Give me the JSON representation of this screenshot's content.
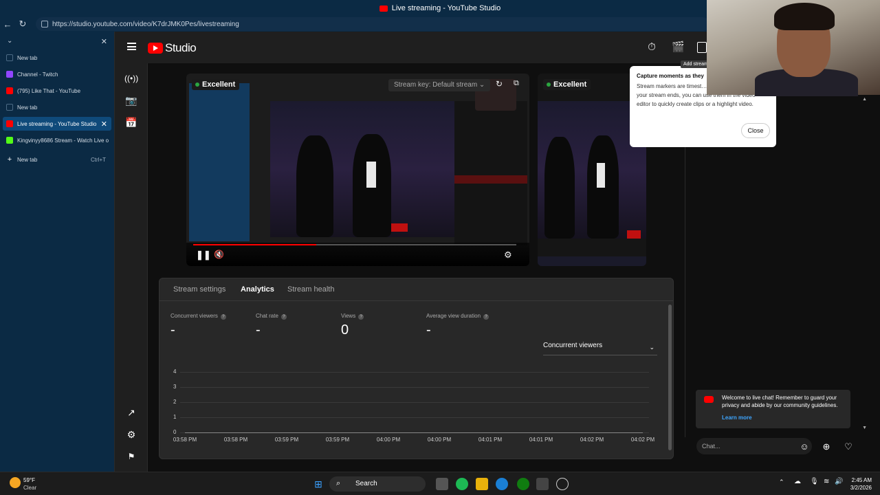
{
  "window": {
    "title": "Live streaming - YouTube Studio"
  },
  "browser": {
    "url": "https://studio.youtube.com/video/K7drJMK0Pes/livestreaming",
    "tabs": [
      {
        "label": "New tab",
        "type": "blank"
      },
      {
        "label": "Channel - Twitch",
        "type": "twitch"
      },
      {
        "label": "(795) Like That - YouTube",
        "type": "youtube"
      },
      {
        "label": "New tab",
        "type": "blank"
      },
      {
        "label": "Live streaming - YouTube Studio",
        "type": "youtube",
        "active": true
      },
      {
        "label": "Kingvinyy8686 Stream - Watch Live o",
        "type": "kick"
      }
    ],
    "new_tab_label": "New tab",
    "new_tab_shortcut": "Ctrl+T"
  },
  "studio": {
    "logo_text": "Studio",
    "preview_main": {
      "badge": "Excellent",
      "stream_key": "Stream key: Default stream"
    },
    "preview_side": {
      "badge": "Excellent"
    },
    "popover": {
      "title": "Capture moments as they",
      "body": "Stream markers are timest… while you're live. Once your stream ends, you can use them in the video editor to quickly create clips or a highlight video.",
      "close_label": "Close"
    },
    "tooltip": "Add stream",
    "analytics": {
      "tabs": [
        "Stream settings",
        "Analytics",
        "Stream health"
      ],
      "active_tab": "Analytics",
      "metrics": [
        {
          "label": "Concurrent viewers",
          "value": "-"
        },
        {
          "label": "Chat rate",
          "value": "-"
        },
        {
          "label": "Views",
          "value": "0"
        },
        {
          "label": "Average view duration",
          "value": "-"
        }
      ],
      "dropdown": "Concurrent viewers",
      "chart_data": {
        "type": "line",
        "y_ticks": [
          "4",
          "3",
          "2",
          "1",
          "0"
        ],
        "x_ticks": [
          "03:58 PM",
          "03:58 PM",
          "03:59 PM",
          "03:59 PM",
          "04:00 PM",
          "04:00 PM",
          "04:01 PM",
          "04:01 PM",
          "04:02 PM",
          "04:02 PM"
        ],
        "ylim": [
          0,
          4
        ],
        "series": [
          {
            "values": [
              0,
              0,
              0,
              0,
              0,
              0,
              0,
              0,
              0,
              0
            ]
          }
        ]
      }
    },
    "chat": {
      "welcome": "Welcome to live chat! Remember to guard your privacy and abide by our community guidelines.",
      "learn_more": "Learn more",
      "placeholder": "Chat..."
    }
  },
  "taskbar": {
    "weather_temp": "59°F",
    "weather_desc": "Clear",
    "search_label": "Search",
    "time": "2:45 AM",
    "date": "3/2/2026"
  }
}
